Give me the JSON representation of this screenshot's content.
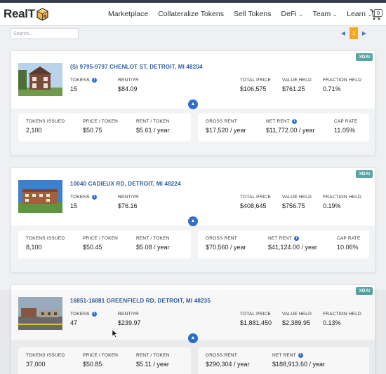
{
  "nav": {
    "logo_text": "RealT",
    "items": [
      {
        "label": "Marketplace"
      },
      {
        "label": "Collateralize Tokens"
      },
      {
        "label": "Sell Tokens"
      },
      {
        "label": "DeFi",
        "dropdown": true
      },
      {
        "label": "Team",
        "dropdown": true
      },
      {
        "label": "Learn",
        "dropdown": true
      }
    ],
    "cart_count": "0",
    "cart_icon": "cart-icon"
  },
  "search": {
    "placeholder": "Search..."
  },
  "pagination": {
    "current": "1",
    "prev_icon": "chevron-left-icon",
    "next_icon": "chevron-right-icon"
  },
  "labels": {
    "tokens": "TOKENS",
    "rent_yr": "RENT/YR",
    "total_price": "TOTAL PRICE",
    "value_held": "VALUE HELD",
    "fraction_held": "FRACTION HELD",
    "tokens_issued": "TOKENS ISSUED",
    "price_token": "PRICE / TOKEN",
    "rent_token": "RENT / TOKEN",
    "gross_rent": "GROSS RENT",
    "net_rent": "NET RENT",
    "cap_rate": "CAP RATE"
  },
  "colors": {
    "accent": "#2f6fd0",
    "badge": "#5aa4a4",
    "pager": "#f5a623",
    "address": "#2f5b9a"
  },
  "properties": [
    {
      "badge": "XDAI",
      "address": "(S) 9795-9797 CHENLOT ST, DETROIT, MI 48204",
      "tokens": "15",
      "rent_yr": "$84.09",
      "total_price": "$106,575",
      "value_held": "$761.25",
      "fraction_held": "0.71%",
      "tokens_issued": "2,100",
      "price_token": "$50.75",
      "rent_token": "$5.61 / year",
      "gross_rent": "$17,520 / year",
      "net_rent": "$11,772.00 / year",
      "cap_rate": "11.05%"
    },
    {
      "badge": "XDAI",
      "address": "10040 CADIEUX RD, DETROIT, MI 48224",
      "tokens": "15",
      "rent_yr": "$76.16",
      "total_price": "$408,645",
      "value_held": "$756.75",
      "fraction_held": "0.19%",
      "tokens_issued": "8,100",
      "price_token": "$50.45",
      "rent_token": "$5.08 / year",
      "gross_rent": "$70,560 / year",
      "net_rent": "$41,124.00 / year",
      "cap_rate": "10.06%"
    },
    {
      "badge": "XDAI",
      "address": "16851-16881 GREENFIELD RD, DETROIT, MI 48235",
      "tokens": "47",
      "rent_yr": "$239.97",
      "total_price": "$1,881,450",
      "value_held": "$2,389.95",
      "fraction_held": "0.13%",
      "tokens_issued": "37,000",
      "price_token": "$50.85",
      "rent_token": "$5.11 / year",
      "gross_rent": "$290,304 / year",
      "net_rent": "$188,913.60 / year"
    }
  ]
}
